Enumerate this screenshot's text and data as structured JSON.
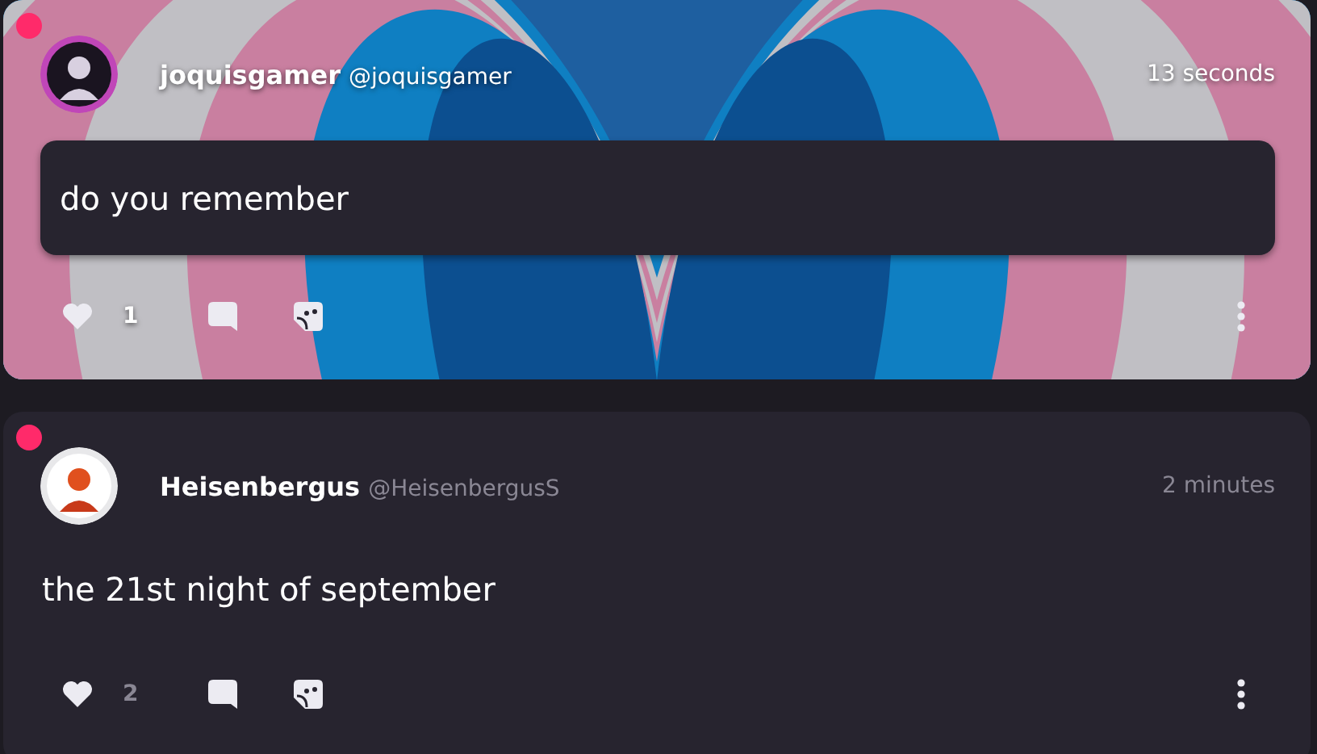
{
  "posts": [
    {
      "kind": "banner",
      "unread": true,
      "author": "joquisgamer",
      "handle": "@joquisgamer",
      "time": "13 seconds",
      "text": "do you remember",
      "likes": "1"
    },
    {
      "kind": "plain",
      "unread": true,
      "author": "Heisenbergus",
      "handle": "@HeisenbergusS",
      "time": "2 minutes",
      "text": "the 21st night of september",
      "likes": "2"
    }
  ]
}
